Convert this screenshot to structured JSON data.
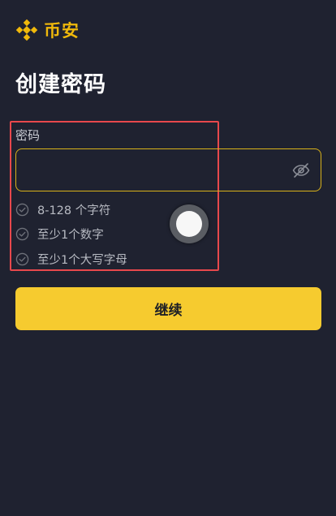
{
  "brand": {
    "name": "币安",
    "icon": "binance-logo-icon",
    "color": "#f0b90b"
  },
  "page_title": "创建密码",
  "password_field": {
    "label": "密码",
    "value": "",
    "placeholder": "",
    "toggle_icon": "eye-off-icon"
  },
  "rules": [
    {
      "text": "8-128 个字符",
      "icon": "check-circle-icon"
    },
    {
      "text": "至少1个数字",
      "icon": "check-circle-icon"
    },
    {
      "text": "至少1个大写字母",
      "icon": "check-circle-icon"
    }
  ],
  "continue_button": {
    "label": "继续",
    "color": "#f6cb2f"
  },
  "colors": {
    "background": "#1f2230",
    "accent": "#f0b90b",
    "highlight": "#e8484c"
  }
}
